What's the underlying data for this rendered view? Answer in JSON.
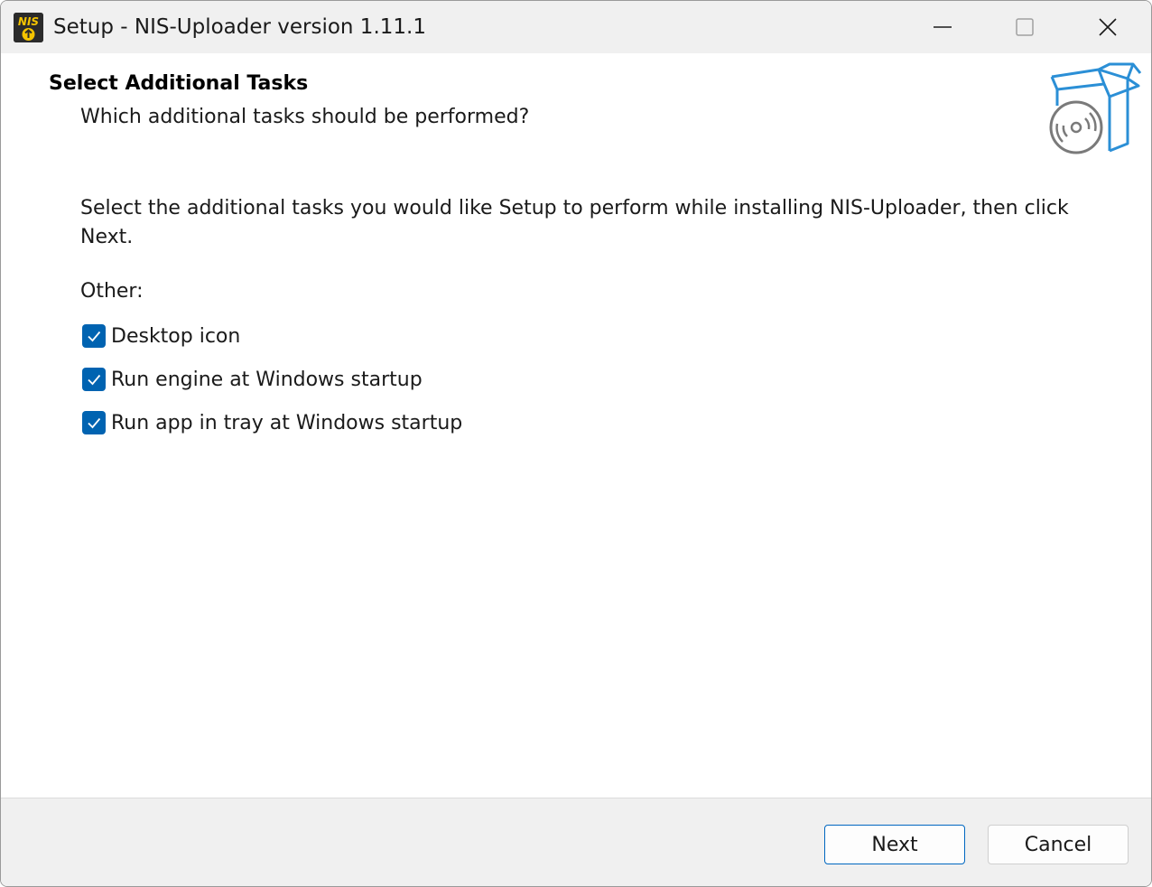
{
  "window": {
    "title": "Setup - NIS-Uploader version 1.11.1",
    "app_icon_text": "NIS"
  },
  "header": {
    "title": "Select Additional Tasks",
    "subtitle": "Which additional tasks should be performed?"
  },
  "main": {
    "description": "Select the additional tasks you would like Setup to perform while installing NIS-Uploader, then click Next.",
    "group_label": "Other:",
    "tasks": [
      {
        "label": "Desktop icon",
        "checked": true
      },
      {
        "label": "Run engine at Windows startup",
        "checked": true
      },
      {
        "label": "Run app in tray at Windows startup",
        "checked": true
      }
    ]
  },
  "footer": {
    "next_label": "Next",
    "cancel_label": "Cancel"
  },
  "colors": {
    "accent": "#0063b1",
    "titlebar_bg": "#f0f0f0",
    "icon_yellow": "#f5c400",
    "box_blue": "#2b8fd6"
  }
}
